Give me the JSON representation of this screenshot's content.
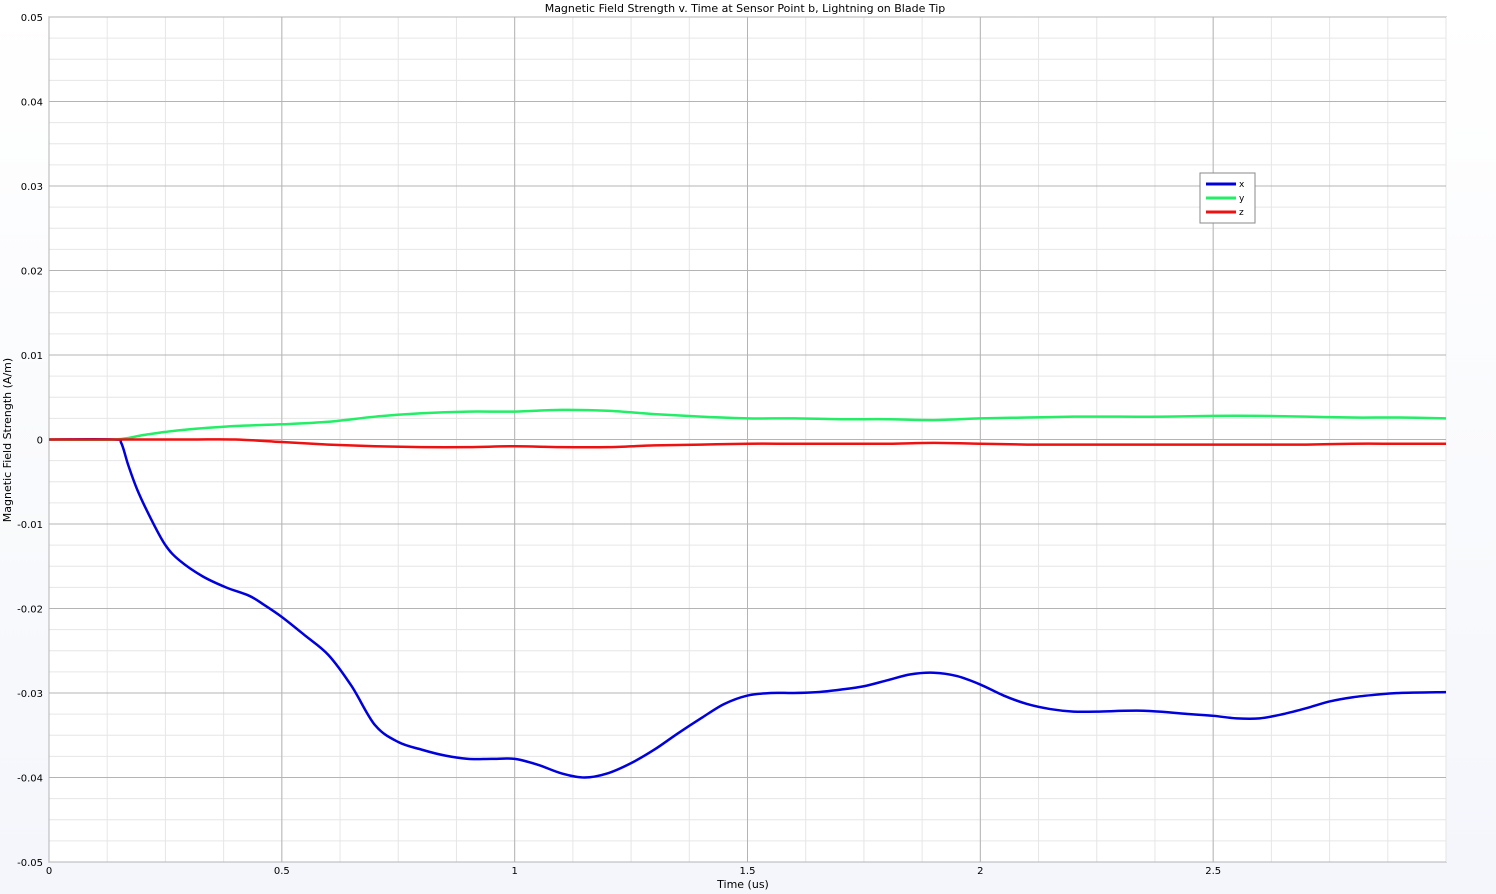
{
  "chart_data": {
    "type": "line",
    "title": "Magnetic Field Strength v. Time at Sensor Point b, Lightning on Blade Tip",
    "xlabel": "Time (us)",
    "ylabel": "Magnetic Field Strength (A/m)",
    "xlim": [
      0,
      3.0
    ],
    "ylim": [
      -0.05,
      0.05
    ],
    "x_ticks": [
      0,
      0.5,
      1,
      1.5,
      2,
      2.5
    ],
    "x_tick_labels": [
      "0",
      "0.5",
      "1",
      "1.5",
      "2",
      "2.5"
    ],
    "y_ticks": [
      0.05,
      0.04,
      0.03,
      0.02,
      0.01,
      0,
      -0.01,
      -0.02,
      -0.03,
      -0.04,
      -0.05
    ],
    "y_tick_labels": [
      "0.05",
      "0.04",
      "0.03",
      "0.02",
      "0.01",
      "0",
      "-0.01",
      "-0.02",
      "-0.03",
      "-0.04",
      "-0.05"
    ],
    "x_minor_step": 0.125,
    "y_minor_step": 0.0025,
    "grid": true,
    "legend_position": "top-right",
    "series": [
      {
        "name": "x",
        "color": "#0000dd",
        "points": [
          [
            0,
            0
          ],
          [
            0.14,
            0
          ],
          [
            0.155,
            -0.0004
          ],
          [
            0.17,
            -0.003
          ],
          [
            0.19,
            -0.006
          ],
          [
            0.22,
            -0.0095
          ],
          [
            0.25,
            -0.0125
          ],
          [
            0.28,
            -0.0143
          ],
          [
            0.33,
            -0.0162
          ],
          [
            0.38,
            -0.0175
          ],
          [
            0.43,
            -0.0185
          ],
          [
            0.46,
            -0.0195
          ],
          [
            0.5,
            -0.021
          ],
          [
            0.55,
            -0.0232
          ],
          [
            0.6,
            -0.0255
          ],
          [
            0.65,
            -0.0292
          ],
          [
            0.7,
            -0.0338
          ],
          [
            0.75,
            -0.0358
          ],
          [
            0.8,
            -0.0367
          ],
          [
            0.85,
            -0.0374
          ],
          [
            0.9,
            -0.0378
          ],
          [
            0.95,
            -0.0378
          ],
          [
            1.0,
            -0.0378
          ],
          [
            1.05,
            -0.0385
          ],
          [
            1.1,
            -0.0395
          ],
          [
            1.15,
            -0.04
          ],
          [
            1.2,
            -0.0395
          ],
          [
            1.25,
            -0.0383
          ],
          [
            1.3,
            -0.0367
          ],
          [
            1.35,
            -0.0348
          ],
          [
            1.4,
            -0.033
          ],
          [
            1.45,
            -0.0313
          ],
          [
            1.5,
            -0.0303
          ],
          [
            1.55,
            -0.03
          ],
          [
            1.6,
            -0.03
          ],
          [
            1.65,
            -0.0299
          ],
          [
            1.7,
            -0.0296
          ],
          [
            1.75,
            -0.0292
          ],
          [
            1.8,
            -0.0285
          ],
          [
            1.85,
            -0.0278
          ],
          [
            1.9,
            -0.0276
          ],
          [
            1.95,
            -0.028
          ],
          [
            2.0,
            -0.029
          ],
          [
            2.05,
            -0.0303
          ],
          [
            2.1,
            -0.0313
          ],
          [
            2.15,
            -0.0319
          ],
          [
            2.2,
            -0.0322
          ],
          [
            2.25,
            -0.0322
          ],
          [
            2.35,
            -0.0321
          ],
          [
            2.45,
            -0.0325
          ],
          [
            2.5,
            -0.0327
          ],
          [
            2.55,
            -0.033
          ],
          [
            2.6,
            -0.033
          ],
          [
            2.65,
            -0.0325
          ],
          [
            2.7,
            -0.0318
          ],
          [
            2.75,
            -0.031
          ],
          [
            2.8,
            -0.0305
          ],
          [
            2.85,
            -0.0302
          ],
          [
            2.9,
            -0.03
          ],
          [
            3.0,
            -0.0299
          ]
        ]
      },
      {
        "name": "y",
        "color": "#22ee66",
        "points": [
          [
            0,
            0
          ],
          [
            0.14,
            0
          ],
          [
            0.2,
            0.0005
          ],
          [
            0.25,
            0.0009
          ],
          [
            0.3,
            0.0012
          ],
          [
            0.4,
            0.0016
          ],
          [
            0.5,
            0.0018
          ],
          [
            0.6,
            0.0021
          ],
          [
            0.7,
            0.0027
          ],
          [
            0.8,
            0.0031
          ],
          [
            0.9,
            0.0033
          ],
          [
            1.0,
            0.0033
          ],
          [
            1.1,
            0.0035
          ],
          [
            1.2,
            0.0034
          ],
          [
            1.3,
            0.003
          ],
          [
            1.4,
            0.0027
          ],
          [
            1.5,
            0.0025
          ],
          [
            1.6,
            0.0025
          ],
          [
            1.7,
            0.0024
          ],
          [
            1.8,
            0.0024
          ],
          [
            1.9,
            0.0023
          ],
          [
            2.0,
            0.0025
          ],
          [
            2.1,
            0.0026
          ],
          [
            2.2,
            0.0027
          ],
          [
            2.3,
            0.0027
          ],
          [
            2.4,
            0.0027
          ],
          [
            2.5,
            0.0028
          ],
          [
            2.6,
            0.0028
          ],
          [
            2.7,
            0.0027
          ],
          [
            2.8,
            0.0026
          ],
          [
            2.9,
            0.0026
          ],
          [
            3.0,
            0.0025
          ]
        ]
      },
      {
        "name": "z",
        "color": "#ee1111",
        "points": [
          [
            0,
            0
          ],
          [
            0.14,
            0
          ],
          [
            0.3,
            0
          ],
          [
            0.4,
            0
          ],
          [
            0.5,
            -0.0003
          ],
          [
            0.6,
            -0.0006
          ],
          [
            0.7,
            -0.0008
          ],
          [
            0.8,
            -0.0009
          ],
          [
            0.9,
            -0.0009
          ],
          [
            1.0,
            -0.0008
          ],
          [
            1.1,
            -0.0009
          ],
          [
            1.2,
            -0.0009
          ],
          [
            1.3,
            -0.0007
          ],
          [
            1.4,
            -0.0006
          ],
          [
            1.5,
            -0.0005
          ],
          [
            1.6,
            -0.0005
          ],
          [
            1.7,
            -0.0005
          ],
          [
            1.8,
            -0.0005
          ],
          [
            1.9,
            -0.0004
          ],
          [
            2.0,
            -0.0005
          ],
          [
            2.1,
            -0.0006
          ],
          [
            2.2,
            -0.0006
          ],
          [
            2.3,
            -0.0006
          ],
          [
            2.4,
            -0.0006
          ],
          [
            2.5,
            -0.0006
          ],
          [
            2.6,
            -0.0006
          ],
          [
            2.7,
            -0.0006
          ],
          [
            2.8,
            -0.0005
          ],
          [
            2.9,
            -0.0005
          ],
          [
            3.0,
            -0.0005
          ]
        ]
      }
    ]
  }
}
